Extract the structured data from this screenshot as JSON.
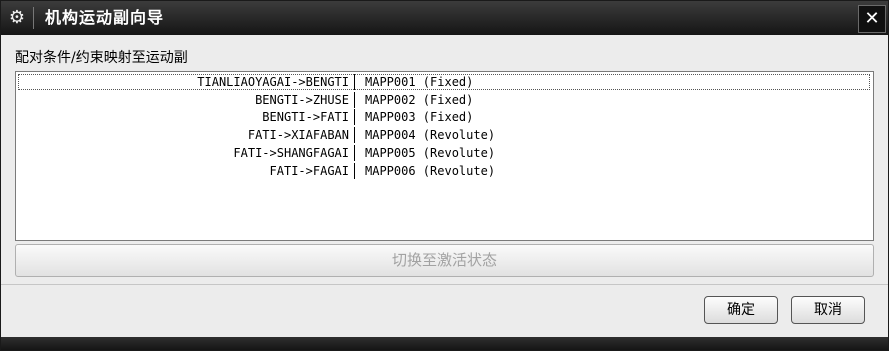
{
  "window": {
    "title": "机构运动副向导",
    "close_glyph": "✕"
  },
  "section_label": "配对条件/约束映射至运动副",
  "list": {
    "rows": [
      {
        "left": "TIANLIAOYAGAI->BENGTI",
        "right": "MAPP001  (Fixed)",
        "selected": true
      },
      {
        "left": "BENGTI->ZHUSE",
        "right": "MAPP002  (Fixed)"
      },
      {
        "left": "BENGTI->FATI",
        "right": "MAPP003  (Fixed)"
      },
      {
        "left": "FATI->XIAFABAN",
        "right": "MAPP004  (Revolute)"
      },
      {
        "left": "FATI->SHANGFAGAI",
        "right": "MAPP005  (Revolute)"
      },
      {
        "left": "FATI->FAGAI",
        "right": "MAPP006  (Revolute)"
      }
    ]
  },
  "toggle_button": {
    "label": "切换至激活状态",
    "enabled": false
  },
  "buttons": {
    "ok": "确定",
    "cancel": "取消"
  },
  "icons": {
    "title": "gear-icon",
    "close": "close-icon"
  },
  "colors": {
    "titlebar": "#1f1f1f",
    "dialog_bg": "#ececec",
    "disabled_text": "#a2a2a2"
  }
}
